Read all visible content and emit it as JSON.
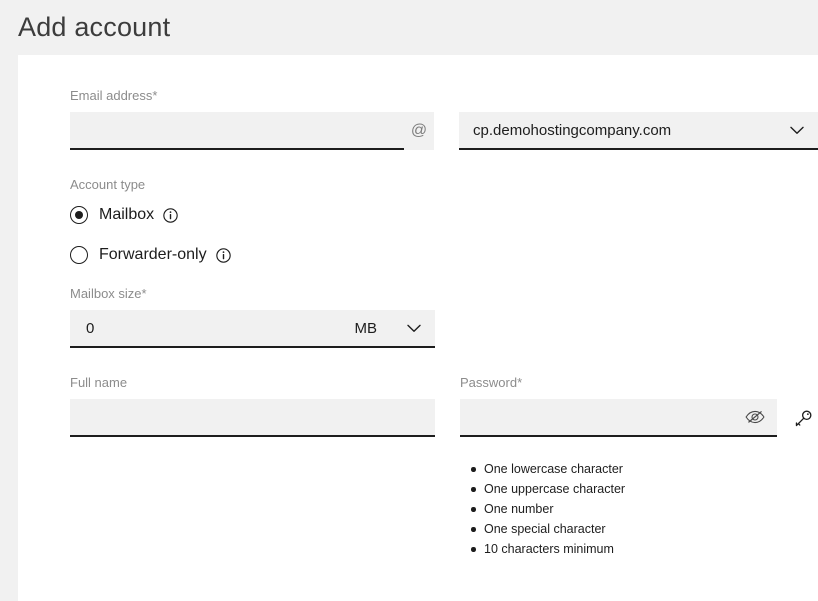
{
  "header": {
    "title": "Add account"
  },
  "form": {
    "email": {
      "label": "Email address*",
      "value": "",
      "placeholder": "",
      "at_icon": "at-icon",
      "at_glyph": "@"
    },
    "domain": {
      "selected": "cp.demohostingcompany.com",
      "chevron_icon": "chevron-down-icon"
    },
    "account_type": {
      "label": "Account type",
      "options": [
        {
          "label": "Mailbox",
          "selected": true,
          "info_icon": "info-icon"
        },
        {
          "label": "Forwarder-only",
          "selected": false,
          "info_icon": "info-icon"
        }
      ]
    },
    "mailbox_size": {
      "label": "Mailbox size*",
      "value": "0",
      "unit": "MB",
      "chevron_icon": "chevron-down-icon"
    },
    "full_name": {
      "label": "Full name",
      "value": "",
      "placeholder": ""
    },
    "password": {
      "label": "Password*",
      "value": "",
      "placeholder": "",
      "toggle_icon": "eye-slash-icon",
      "generate_icon": "key-icon",
      "requirements": [
        "One lowercase character",
        "One uppercase character",
        "One number",
        "One special character",
        "10 characters minimum"
      ]
    }
  },
  "colors": {
    "page_background": "#f1f1f1",
    "card_background": "#ffffff",
    "field_background": "#f1f1f1",
    "field_underline": "#1d1d1d",
    "label_text": "#8c8c8c",
    "value_text": "#1d1d1d"
  }
}
